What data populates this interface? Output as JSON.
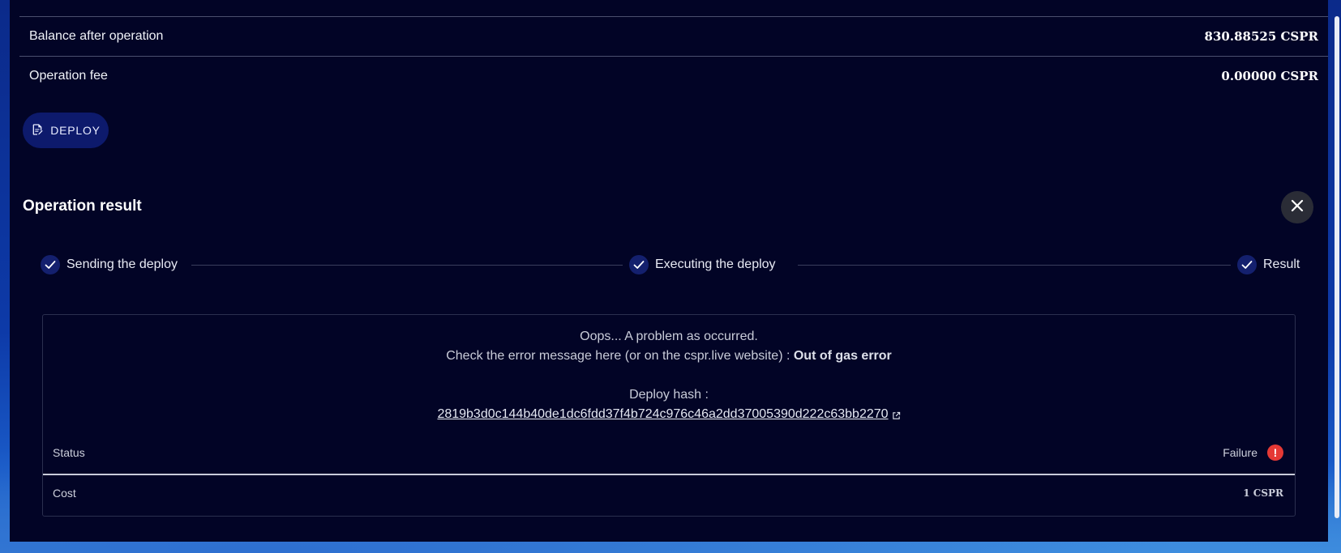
{
  "summary": {
    "balance_label": "Balance after operation",
    "balance_value": "830.88525 CSPR",
    "fee_label": "Operation fee",
    "fee_value": "0.00000 CSPR"
  },
  "deploy_button": {
    "label": "DEPLOY",
    "icon": "edit-document-icon"
  },
  "result": {
    "title": "Operation result",
    "close_icon": "close-icon",
    "steps": [
      {
        "label": "Sending the deploy",
        "done": true
      },
      {
        "label": "Executing the deploy",
        "done": true
      },
      {
        "label": "Result",
        "done": true
      }
    ],
    "message_line1": "Oops... A problem as occurred.",
    "message_line2_prefix": "Check the error message here (or on the cspr.live website) : ",
    "message_line2_error": "Out of gas error",
    "hash_label": "Deploy hash :",
    "hash_value": "2819b3d0c144b40de1dc6fdd37f4b724c976c46a2dd37005390d222c63bb2270",
    "status_label": "Status",
    "status_value": "Failure",
    "status_icon": "error-icon",
    "cost_label": "Cost",
    "cost_value": "1 CSPR"
  },
  "colors": {
    "panel_bg": "#020426",
    "accent": "#14206e",
    "error": "#e53935"
  }
}
